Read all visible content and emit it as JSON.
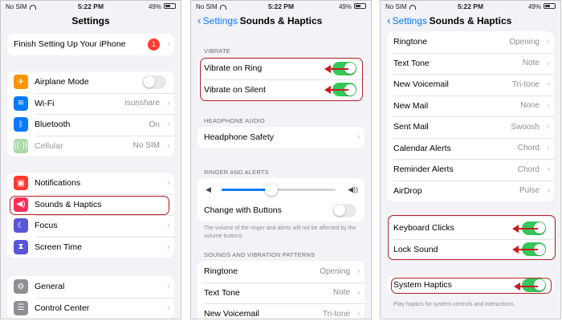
{
  "status": {
    "carrier": "No SIM",
    "time": "5:22 PM",
    "battery": "49%"
  },
  "colors": {
    "accent": "#0a7aff",
    "toggle_on": "#34c759",
    "highlight": "#b01e23"
  },
  "panel1": {
    "title": "Settings",
    "finish": {
      "label": "Finish Setting Up Your iPhone",
      "badge": "1"
    },
    "connectivity": [
      {
        "icon": "airplane-icon",
        "label": "Airplane Mode",
        "toggle": "off"
      },
      {
        "icon": "wifi-icon",
        "label": "Wi-Fi",
        "value": "isunshare"
      },
      {
        "icon": "bluetooth-icon",
        "label": "Bluetooth",
        "value": "On"
      },
      {
        "icon": "cellular-icon",
        "label": "Cellular",
        "value": "No SIM"
      }
    ],
    "alerts": [
      {
        "icon": "notifications-icon",
        "label": "Notifications"
      },
      {
        "icon": "sounds-icon",
        "label": "Sounds & Haptics"
      },
      {
        "icon": "focus-icon",
        "label": "Focus"
      },
      {
        "icon": "screen-time-icon",
        "label": "Screen Time"
      }
    ],
    "general": [
      {
        "icon": "gear-icon",
        "label": "General"
      },
      {
        "icon": "control-center-icon",
        "label": "Control Center"
      }
    ]
  },
  "panel2": {
    "back": "Settings",
    "title": "Sounds & Haptics",
    "vibrate_header": "VIBRATE",
    "vibrate": [
      {
        "label": "Vibrate on Ring",
        "toggle": "on"
      },
      {
        "label": "Vibrate on Silent",
        "toggle": "on"
      }
    ],
    "headphone_header": "HEADPHONE AUDIO",
    "headphone_safety": "Headphone Safety",
    "ringer_header": "RINGER AND ALERTS",
    "ringer_volume": 0.44,
    "change_with_buttons": {
      "label": "Change with Buttons",
      "toggle": "off"
    },
    "ringer_note": "The volume of the ringer and alerts will not be affected by the volume buttons.",
    "patterns_header": "SOUNDS AND VIBRATION PATTERNS",
    "patterns": [
      {
        "label": "Ringtone",
        "value": "Opening"
      },
      {
        "label": "Text Tone",
        "value": "Note"
      },
      {
        "label": "New Voicemail",
        "value": "Tri-tone"
      }
    ]
  },
  "panel3": {
    "back": "Settings",
    "title": "Sounds & Haptics",
    "patterns": [
      {
        "label": "Ringtone",
        "value": "Opening"
      },
      {
        "label": "Text Tone",
        "value": "Note"
      },
      {
        "label": "New Voicemail",
        "value": "Tri-tone"
      },
      {
        "label": "New Mail",
        "value": "None"
      },
      {
        "label": "Sent Mail",
        "value": "Swoosh"
      },
      {
        "label": "Calendar Alerts",
        "value": "Chord"
      },
      {
        "label": "Reminder Alerts",
        "value": "Chord"
      },
      {
        "label": "AirDrop",
        "value": "Pulse"
      }
    ],
    "clicks": [
      {
        "label": "Keyboard Clicks",
        "toggle": "on"
      },
      {
        "label": "Lock Sound",
        "toggle": "on"
      }
    ],
    "system_haptics": {
      "label": "System Haptics",
      "toggle": "on"
    },
    "haptics_note": "Play haptics for system controls and interactions."
  }
}
